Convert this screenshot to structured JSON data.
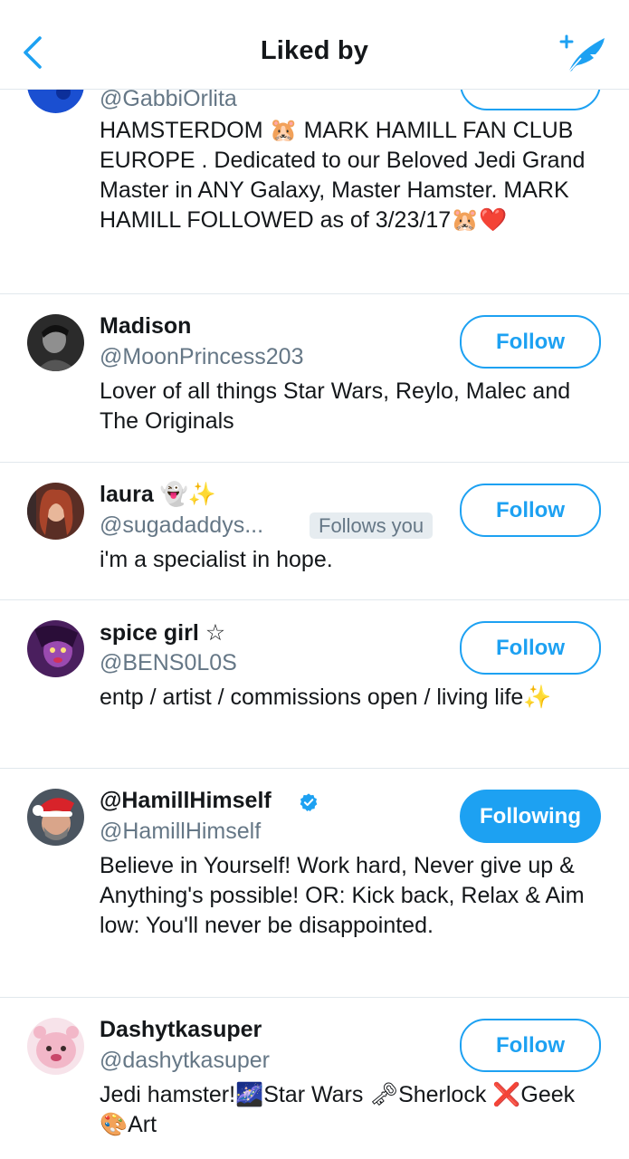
{
  "header": {
    "title": "Liked by",
    "back_icon": "chevron-left-icon",
    "compose_icon": "compose-tweet-icon",
    "accent": "#1da1f2"
  },
  "users": [
    {
      "handle": "@GabbiOrlita",
      "bio": "HAMSTERDOM 🐹 MARK HAMILL FAN CLUB EUROPE . Dedicated to our Beloved Jedi Grand Master in ANY Galaxy, Master Hamster. MARK HAMILL FOLLOWED as of 3/23/17🐹❤️"
    },
    {
      "name": "Madison",
      "handle": "@MoonPrincess203",
      "bio": "Lover of all things Star Wars, Reylo, Malec and The Originals",
      "button": "Follow"
    },
    {
      "name": "laura 👻✨",
      "handle": "@sugadaddys...",
      "follows_you": "Follows you",
      "bio": "i'm a specialist in hope.",
      "button": "Follow"
    },
    {
      "name": "spice girl ☆",
      "handle": "@BENS0L0S",
      "bio": "entp / artist / commissions open / living life✨",
      "button": "Follow"
    },
    {
      "name": "@HamillHimself",
      "verified": true,
      "handle": "@HamillHimself",
      "bio": "Believe in Yourself! Work hard, Never give up & Anything's possible! OR: Kick back, Relax & Aim low: You'll never be disappointed.",
      "button": "Following"
    },
    {
      "name": "Dashytkasuper",
      "handle": "@dashytkasuper",
      "bio": "Jedi hamster!🌌Star Wars 🗝Sherlock ❌Geek 🎨Art",
      "button": "Follow"
    }
  ]
}
